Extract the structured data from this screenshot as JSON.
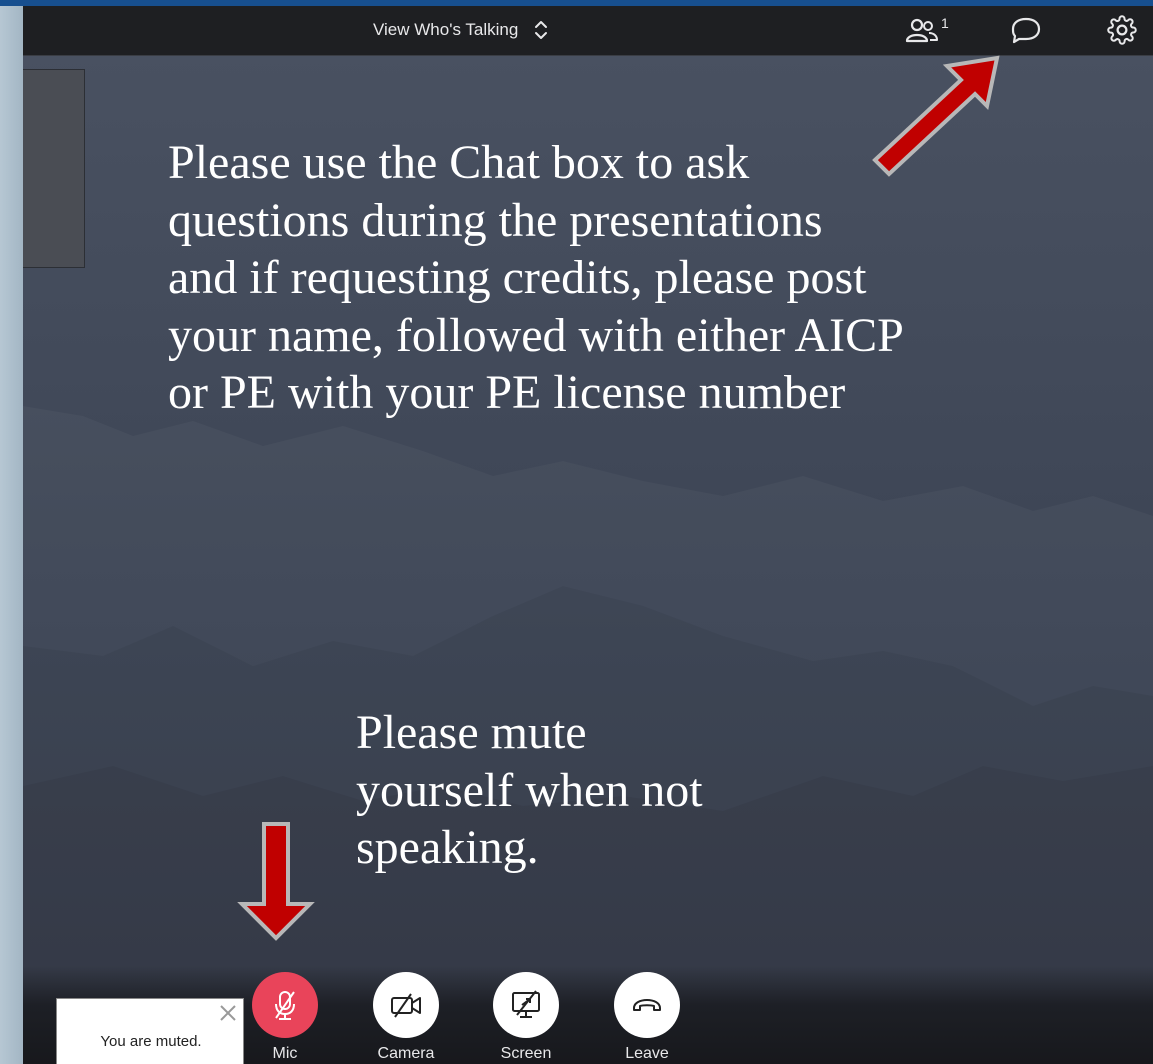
{
  "topbar": {
    "view_label": "View Who's Talking",
    "participant_count": "1",
    "icons": [
      "participants-icon",
      "chat-icon",
      "settings-icon",
      "chevron-updown-icon"
    ]
  },
  "slide": {
    "chat_instruction": "Please use the Chat box to ask\nquestions during the presentations\nand if requesting credits, please post\nyour name, followed with either AICP\nor PE with your PE license number",
    "mute_instruction": "Please mute\nyourself when not\nspeaking.",
    "arrow_color": "#c00000"
  },
  "controls": [
    {
      "label": "Mic",
      "icon": "mic-off-icon",
      "state": "muted"
    },
    {
      "label": "Camera",
      "icon": "camera-off-icon"
    },
    {
      "label": "Screen",
      "icon": "screen-share-off-icon"
    },
    {
      "label": "Leave",
      "icon": "hang-up-icon"
    }
  ],
  "toast": {
    "message": "You are muted."
  },
  "colors": {
    "topbar_bg": "#1e1f22",
    "mic_muted": "#e9445a",
    "window_accent": "#1b5aa0"
  }
}
